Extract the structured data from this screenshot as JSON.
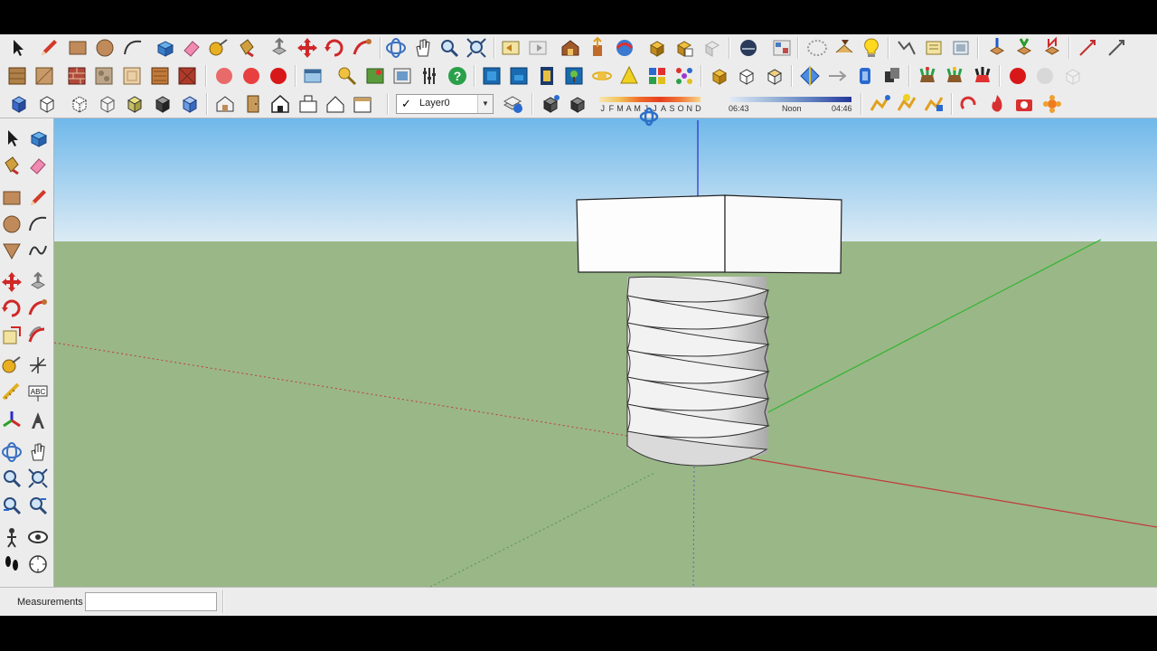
{
  "toolbar": {
    "layer_checked": "✓",
    "layer_name": "Layer0",
    "shadow": {
      "months": [
        "J",
        "F",
        "M",
        "A",
        "M",
        "J",
        "J",
        "A",
        "S",
        "O",
        "N",
        "D"
      ],
      "time_start": "06:43",
      "time_mid": "Noon",
      "time_end": "04:46"
    }
  },
  "status": {
    "measurements_label": "Measurements",
    "measurements_value": ""
  },
  "colors": {
    "sky_top": "#6fb8ea",
    "sky_bottom": "#dcebf5",
    "ground": "#9ab787",
    "axis_red": "#c23a3a",
    "axis_green": "#2fb52f",
    "axis_blue": "#2a2ad0"
  },
  "icons": [
    "select-icon",
    "pencil-icon",
    "rectangle-icon",
    "circle-icon",
    "arc-icon",
    "make-component-icon",
    "eraser-icon",
    "tape-measure-icon",
    "paint-bucket-icon",
    "push-pull-icon",
    "move-icon",
    "rotate-icon",
    "follow-me-icon",
    "orbit-icon",
    "pan-icon",
    "zoom-icon",
    "zoom-extents-icon",
    "walk-icon",
    "look-around-icon",
    "section-plane-icon",
    "shadows-icon",
    "fog-icon",
    "layer-manager-icon"
  ]
}
